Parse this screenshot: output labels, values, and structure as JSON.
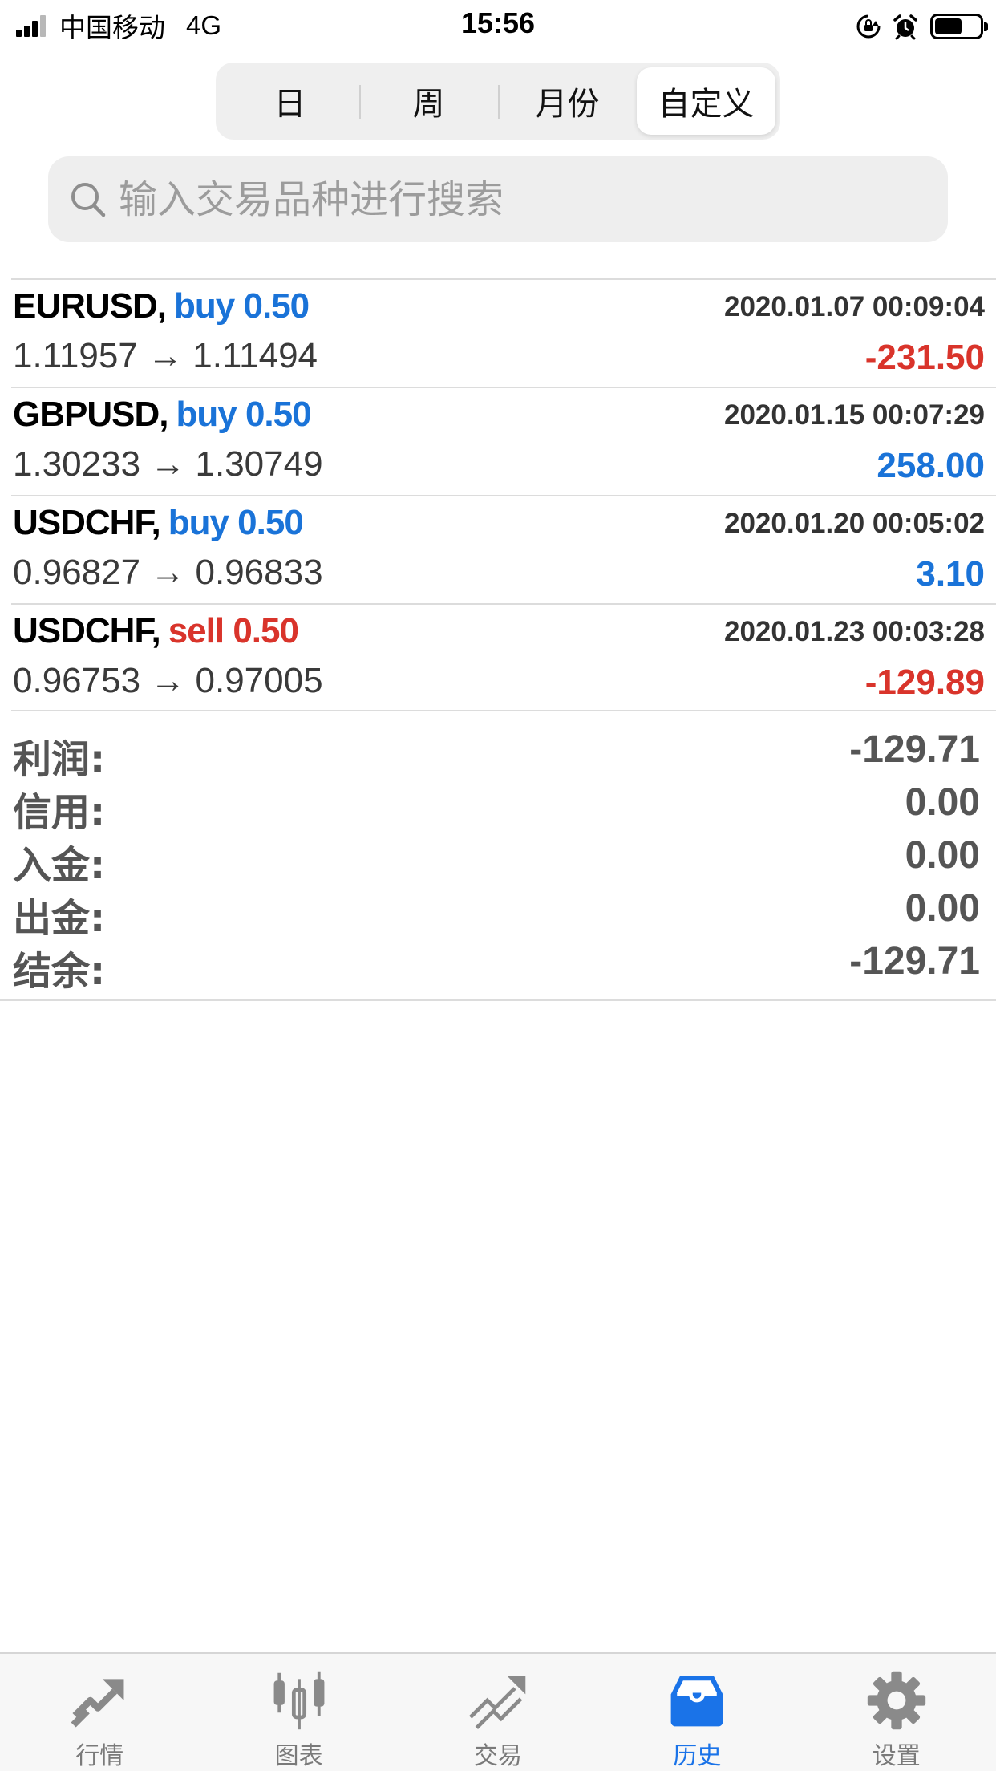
{
  "status_bar": {
    "carrier": "中国移动",
    "network": "4G",
    "time": "15:56",
    "icons": [
      "signal-icon",
      "orientation-lock-icon",
      "alarm-icon",
      "battery-icon"
    ]
  },
  "period_tabs": [
    {
      "label": "日",
      "active": false
    },
    {
      "label": "周",
      "active": false
    },
    {
      "label": "月份",
      "active": false
    },
    {
      "label": "自定义",
      "active": true
    }
  ],
  "search": {
    "placeholder": "输入交易品种进行搜索",
    "icon": "search-icon"
  },
  "trades": [
    {
      "symbol": "EURUSD,",
      "side": "buy",
      "volume": "0.50",
      "datetime": "2020.01.07 00:09:04",
      "prices": "1.11957 → 1.11494",
      "profit": "-231.50"
    },
    {
      "symbol": "GBPUSD,",
      "side": "buy",
      "volume": "0.50",
      "datetime": "2020.01.15 00:07:29",
      "prices": "1.30233 → 1.30749",
      "profit": "258.00"
    },
    {
      "symbol": "USDCHF,",
      "side": "buy",
      "volume": "0.50",
      "datetime": "2020.01.20 00:05:02",
      "prices": "0.96827 → 0.96833",
      "profit": "3.10"
    },
    {
      "symbol": "USDCHF,",
      "side": "sell",
      "volume": "0.50",
      "datetime": "2020.01.23 00:03:28",
      "prices": "0.96753 → 0.97005",
      "profit": "-129.89"
    }
  ],
  "summary": [
    {
      "label": "利润:",
      "value": "-129.71"
    },
    {
      "label": "信用:",
      "value": "0.00"
    },
    {
      "label": "入金:",
      "value": "0.00"
    },
    {
      "label": "出金:",
      "value": "0.00"
    },
    {
      "label": "结余:",
      "value": "-129.71"
    }
  ],
  "tab_bar": [
    {
      "label": "行情",
      "icon": "quotes-icon",
      "active": false
    },
    {
      "label": "图表",
      "icon": "chart-icon",
      "active": false
    },
    {
      "label": "交易",
      "icon": "trade-icon",
      "active": false
    },
    {
      "label": "历史",
      "icon": "history-icon",
      "active": true
    },
    {
      "label": "设置",
      "icon": "settings-icon",
      "active": false
    }
  ],
  "colors": {
    "buy": "#1a73d8",
    "sell": "#d9342b",
    "profit_positive": "#1a73d8",
    "profit_negative": "#d9342b",
    "active_tab": "#1a73e8",
    "inactive_tab": "#7a7a7a"
  }
}
